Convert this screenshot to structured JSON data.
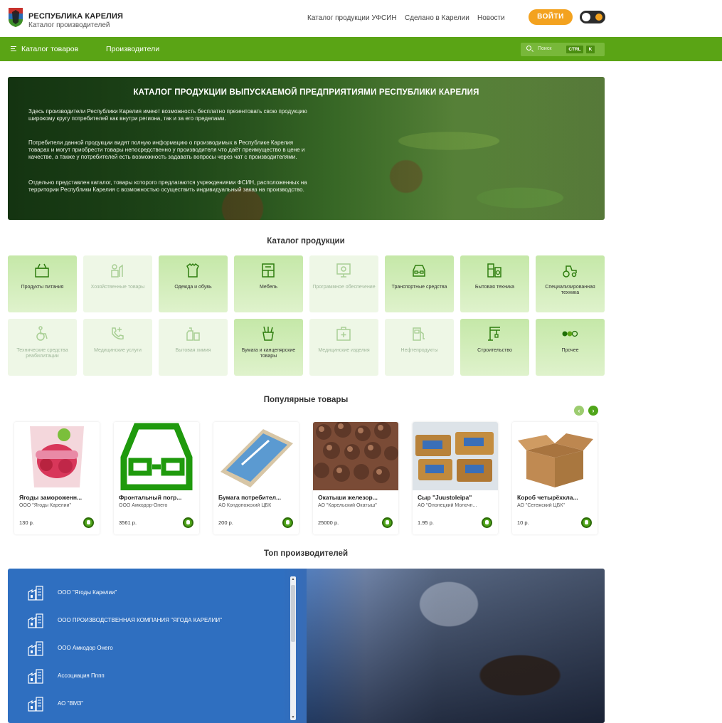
{
  "header": {
    "brand_title": "РЕСПУБЛИКА КАРЕЛИЯ",
    "brand_subtitle": "Каталог производителей",
    "nav": [
      "Каталог продукции УФСИН",
      "Сделано в Карелии",
      "Новости"
    ],
    "login_label": "ВОЙТИ"
  },
  "menubar": {
    "catalog_label": "Каталог товаров",
    "producers_label": "Производители",
    "search_placeholder": "Поиск",
    "shortcut_keys": [
      "CTRL",
      "K"
    ]
  },
  "hero": {
    "title": "КАТАЛОГ ПРОДУКЦИИ ВЫПУСКАЕМОЙ ПРЕДПРИЯТИЯМИ РЕСПУБЛИКИ КАРЕЛИЯ",
    "paragraphs": [
      "Здесь производители Республики Карелия имеют возможность бесплатно презентовать свою продукцию широкому кругу потребителей как внутри региона, так и за его пределами.",
      "Потребители данной продукции видят полную информацию о производимых в Республике Карелия товарах и могут приобрести товары непосредственно у производителя что даёт преимущество в цене и качестве, а также у потребителей есть возможность задавать вопросы через чат с производителями.",
      "Отдельно представлен каталог, товары которого предлагаются учреждениями ФСИН, расположенных на территории Республики Карелия с возможностью осуществить индивидуальный заказ на производство."
    ]
  },
  "catalog": {
    "title": "Каталог продукции",
    "tiles": [
      {
        "label": "Продукты питания",
        "icon": "food-basket-icon",
        "active": true
      },
      {
        "label": "Хозяйственные товары",
        "icon": "household-goods-icon",
        "active": false
      },
      {
        "label": "Одежда и обувь",
        "icon": "clothing-icon",
        "active": true
      },
      {
        "label": "Мебель",
        "icon": "furniture-icon",
        "active": true
      },
      {
        "label": "Программное обеспечение",
        "icon": "software-icon",
        "active": false
      },
      {
        "label": "Транспортные средства",
        "icon": "car-icon",
        "active": true
      },
      {
        "label": "Бытовая техника",
        "icon": "appliance-icon",
        "active": true
      },
      {
        "label": "Специализированная техника",
        "icon": "tractor-icon",
        "active": true
      },
      {
        "label": "Технические средства реабилитации",
        "icon": "wheelchair-icon",
        "active": false
      },
      {
        "label": "Медицинские услуги",
        "icon": "phone-medical-icon",
        "active": false
      },
      {
        "label": "Бытовая химия",
        "icon": "chemicals-icon",
        "active": false
      },
      {
        "label": "Бумага и канцелярские товары",
        "icon": "stationery-icon",
        "active": true
      },
      {
        "label": "Медицинские изделия",
        "icon": "medkit-icon",
        "active": false
      },
      {
        "label": "Нефтепродукты",
        "icon": "fuel-icon",
        "active": false
      },
      {
        "label": "Строительство",
        "icon": "crane-icon",
        "active": true
      },
      {
        "label": "Прочее",
        "icon": "other-dots-icon",
        "active": true
      }
    ]
  },
  "popular": {
    "title": "Популярные товары",
    "items": [
      {
        "name": "Ягоды замороженн...",
        "maker": "ООО \"Ягоды Карелии\"",
        "price": "130 р.",
        "image": "berries-package"
      },
      {
        "name": "Фронтальный погр...",
        "maker": "ООО Амкодор-Онего",
        "price": "3561 р.",
        "image": "car-icon"
      },
      {
        "name": "Бумага потребител...",
        "maker": "АО Кондопожский ЦБК",
        "price": "200 р.",
        "image": "paper-ream"
      },
      {
        "name": "Окатыши железор...",
        "maker": "АО \"Карельский Окатыш\"",
        "price": "25000 р.",
        "image": "iron-pellets"
      },
      {
        "name": "Сыр \"Juustoleipa\"",
        "maker": "АО \"Олонецкий Молочн...",
        "price": "1.95 р.",
        "image": "cheese"
      },
      {
        "name": "Короб четырёхкла...",
        "maker": "АО \"Сегежский ЦБК\"",
        "price": "10 р.",
        "image": "cardboard-box"
      }
    ]
  },
  "producers": {
    "title": "Топ производителей",
    "items": [
      "ООО \"Ягоды Карелии\"",
      "ООО ПРОИЗВОДСТВЕННАЯ КОМПАНИЯ \"ЯГОДА КАРЕЛИИ\"",
      "ООО Амкодор Онего",
      "Ассоциация Пппп",
      "АО \"ВМЗ\""
    ]
  },
  "colors": {
    "brand_green": "#5aa415",
    "accent_orange": "#f3a21f",
    "producers_blue": "#2f6fc0"
  }
}
